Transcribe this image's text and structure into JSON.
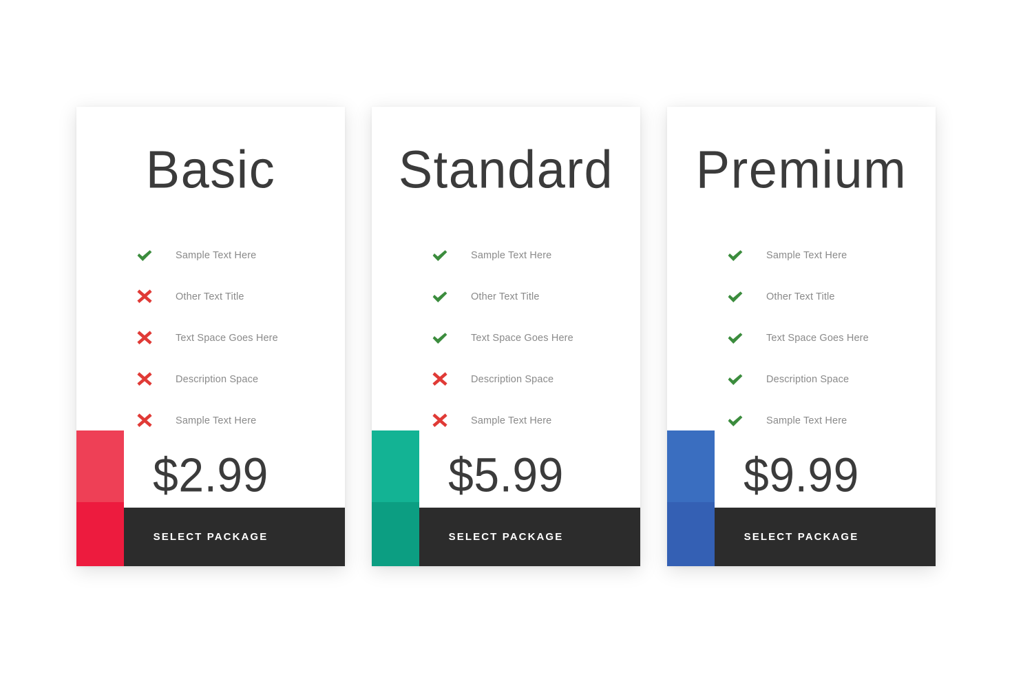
{
  "page": {
    "background_color": "#ffffff",
    "button_background": "#2c2c2c",
    "title_color": "#3b3b3b",
    "feature_text_color": "#8a8a8a",
    "check_icon_color": "#3b8c3d",
    "cross_icon_color": "#e03a36"
  },
  "plans": [
    {
      "name": "Basic",
      "price": "$2.99",
      "cta_label": "Select Package",
      "accent_color_top": "#ee4056",
      "accent_color_bottom": "#ed1b3e",
      "features": [
        {
          "label": "Sample Text Here",
          "icon": "check-icon",
          "included": true
        },
        {
          "label": "Other Text Title",
          "icon": "cross-icon",
          "included": false
        },
        {
          "label": "Text Space Goes Here",
          "icon": "cross-icon",
          "included": false
        },
        {
          "label": "Description Space",
          "icon": "cross-icon",
          "included": false
        },
        {
          "label": "Sample Text Here",
          "icon": "cross-icon",
          "included": false
        }
      ]
    },
    {
      "name": "Standard",
      "price": "$5.99",
      "cta_label": "Select Package",
      "accent_color_top": "#13b394",
      "accent_color_bottom": "#0c9e82",
      "features": [
        {
          "label": "Sample Text Here",
          "icon": "check-icon",
          "included": true
        },
        {
          "label": "Other Text Title",
          "icon": "check-icon",
          "included": true
        },
        {
          "label": "Text Space Goes Here",
          "icon": "check-icon",
          "included": true
        },
        {
          "label": "Description Space",
          "icon": "cross-icon",
          "included": false
        },
        {
          "label": "Sample Text Here",
          "icon": "cross-icon",
          "included": false
        }
      ]
    },
    {
      "name": "Premium",
      "price": "$9.99",
      "cta_label": "Select Package",
      "accent_color_top": "#3a6ec0",
      "accent_color_bottom": "#3460b4",
      "features": [
        {
          "label": "Sample Text Here",
          "icon": "check-icon",
          "included": true
        },
        {
          "label": "Other Text Title",
          "icon": "check-icon",
          "included": true
        },
        {
          "label": "Text Space Goes Here",
          "icon": "check-icon",
          "included": true
        },
        {
          "label": "Description Space",
          "icon": "check-icon",
          "included": true
        },
        {
          "label": "Sample Text Here",
          "icon": "check-icon",
          "included": true
        }
      ]
    }
  ]
}
